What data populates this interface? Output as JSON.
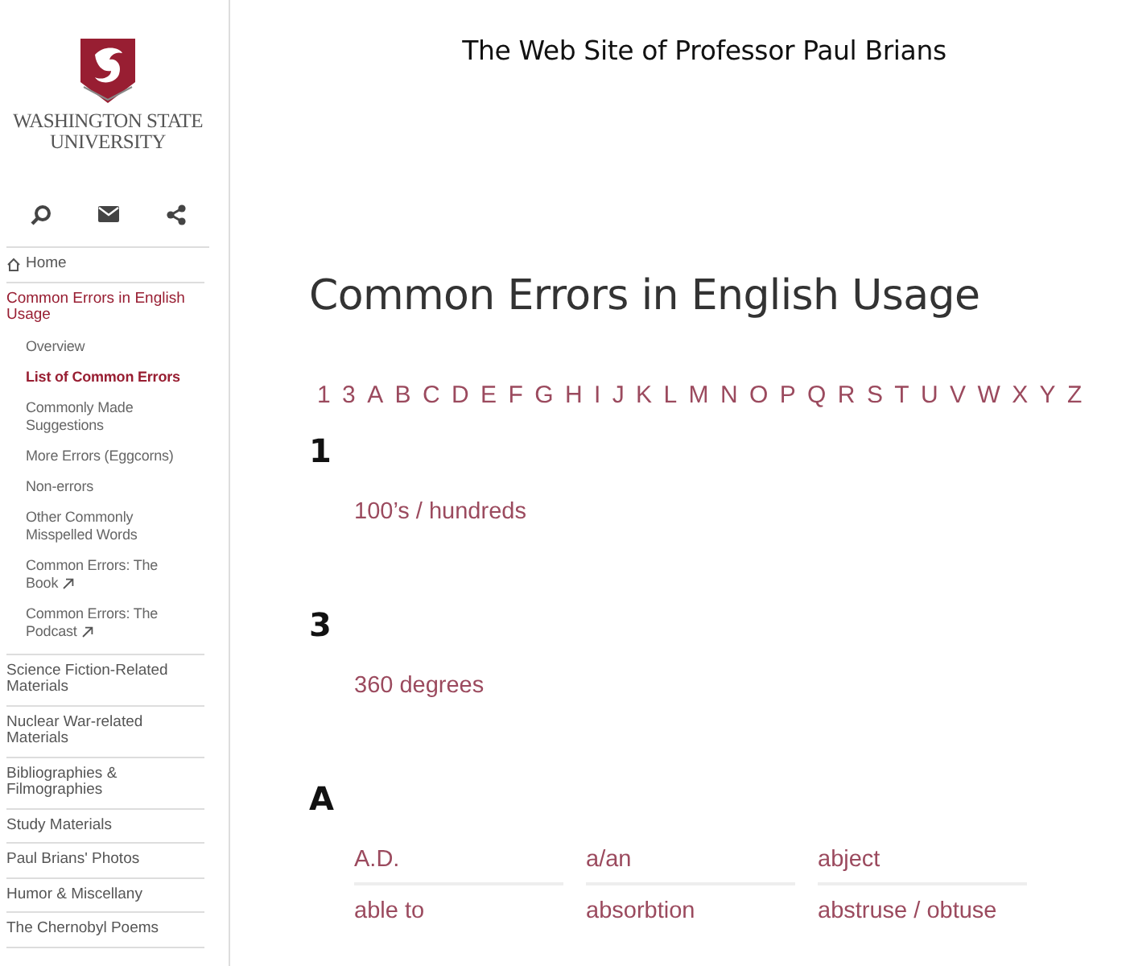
{
  "logo": {
    "line_1": "WASHINGTON STATE",
    "line_2": "UNIVERSITY"
  },
  "site_title": "The Web Site of Professor Paul Brians",
  "toolbar": [
    {
      "kind": "search"
    },
    {
      "kind": "email"
    },
    {
      "kind": "share"
    }
  ],
  "nav": [
    {
      "label": "Home",
      "kind": "home",
      "selected": false
    },
    {
      "label": "Common Errors in English Usage",
      "kind": "section",
      "selected": false,
      "expanded": true,
      "children": [
        {
          "label": "Overview",
          "selected": false,
          "external": false
        },
        {
          "label": "List of Common Errors",
          "selected": true,
          "external": false
        },
        {
          "label": "Commonly Made Suggestions",
          "selected": false,
          "external": false
        },
        {
          "label": "More Errors (Eggcorns)",
          "selected": false,
          "external": false
        },
        {
          "label": "Non-errors",
          "selected": false,
          "external": false
        },
        {
          "label": "Other Commonly Misspelled Words",
          "selected": false,
          "external": false
        },
        {
          "label": "Common Errors: The Book",
          "selected": false,
          "external": true
        },
        {
          "label": "Common Errors: The Podcast",
          "selected": false,
          "external": true
        }
      ]
    },
    {
      "label": "Science Fiction-Related Materials",
      "kind": "plain",
      "selected": false
    },
    {
      "label": "Nuclear War-related Materials",
      "kind": "plain",
      "selected": false
    },
    {
      "label": "Bibliographies & Filmographies",
      "kind": "plain",
      "selected": false
    },
    {
      "label": "Study Materials",
      "kind": "plain",
      "selected": false
    },
    {
      "label": "Paul Brians' Photos",
      "kind": "plain",
      "selected": false
    },
    {
      "label": "Humor & Miscellany",
      "kind": "plain",
      "selected": false
    },
    {
      "label": "The Chernobyl Poems",
      "kind": "plain",
      "selected": false
    }
  ],
  "page_title": "Common Errors in English Usage",
  "alphabet": [
    "1",
    "3",
    "A",
    "B",
    "C",
    "D",
    "E",
    "F",
    "G",
    "H",
    "I",
    "J",
    "K",
    "L",
    "M",
    "N",
    "O",
    "P",
    "Q",
    "R",
    "S",
    "T",
    "U",
    "V",
    "W",
    "X",
    "Y",
    "Z"
  ],
  "sections": [
    {
      "heading": "1",
      "entries": [
        "100’s / hundreds"
      ]
    },
    {
      "heading": "3",
      "entries": [
        "360 degrees"
      ]
    },
    {
      "heading": "A",
      "entries": [
        "A.D.",
        "a/an",
        "abject",
        "able to",
        "absorbtion",
        "abstruse / obtuse"
      ]
    }
  ]
}
